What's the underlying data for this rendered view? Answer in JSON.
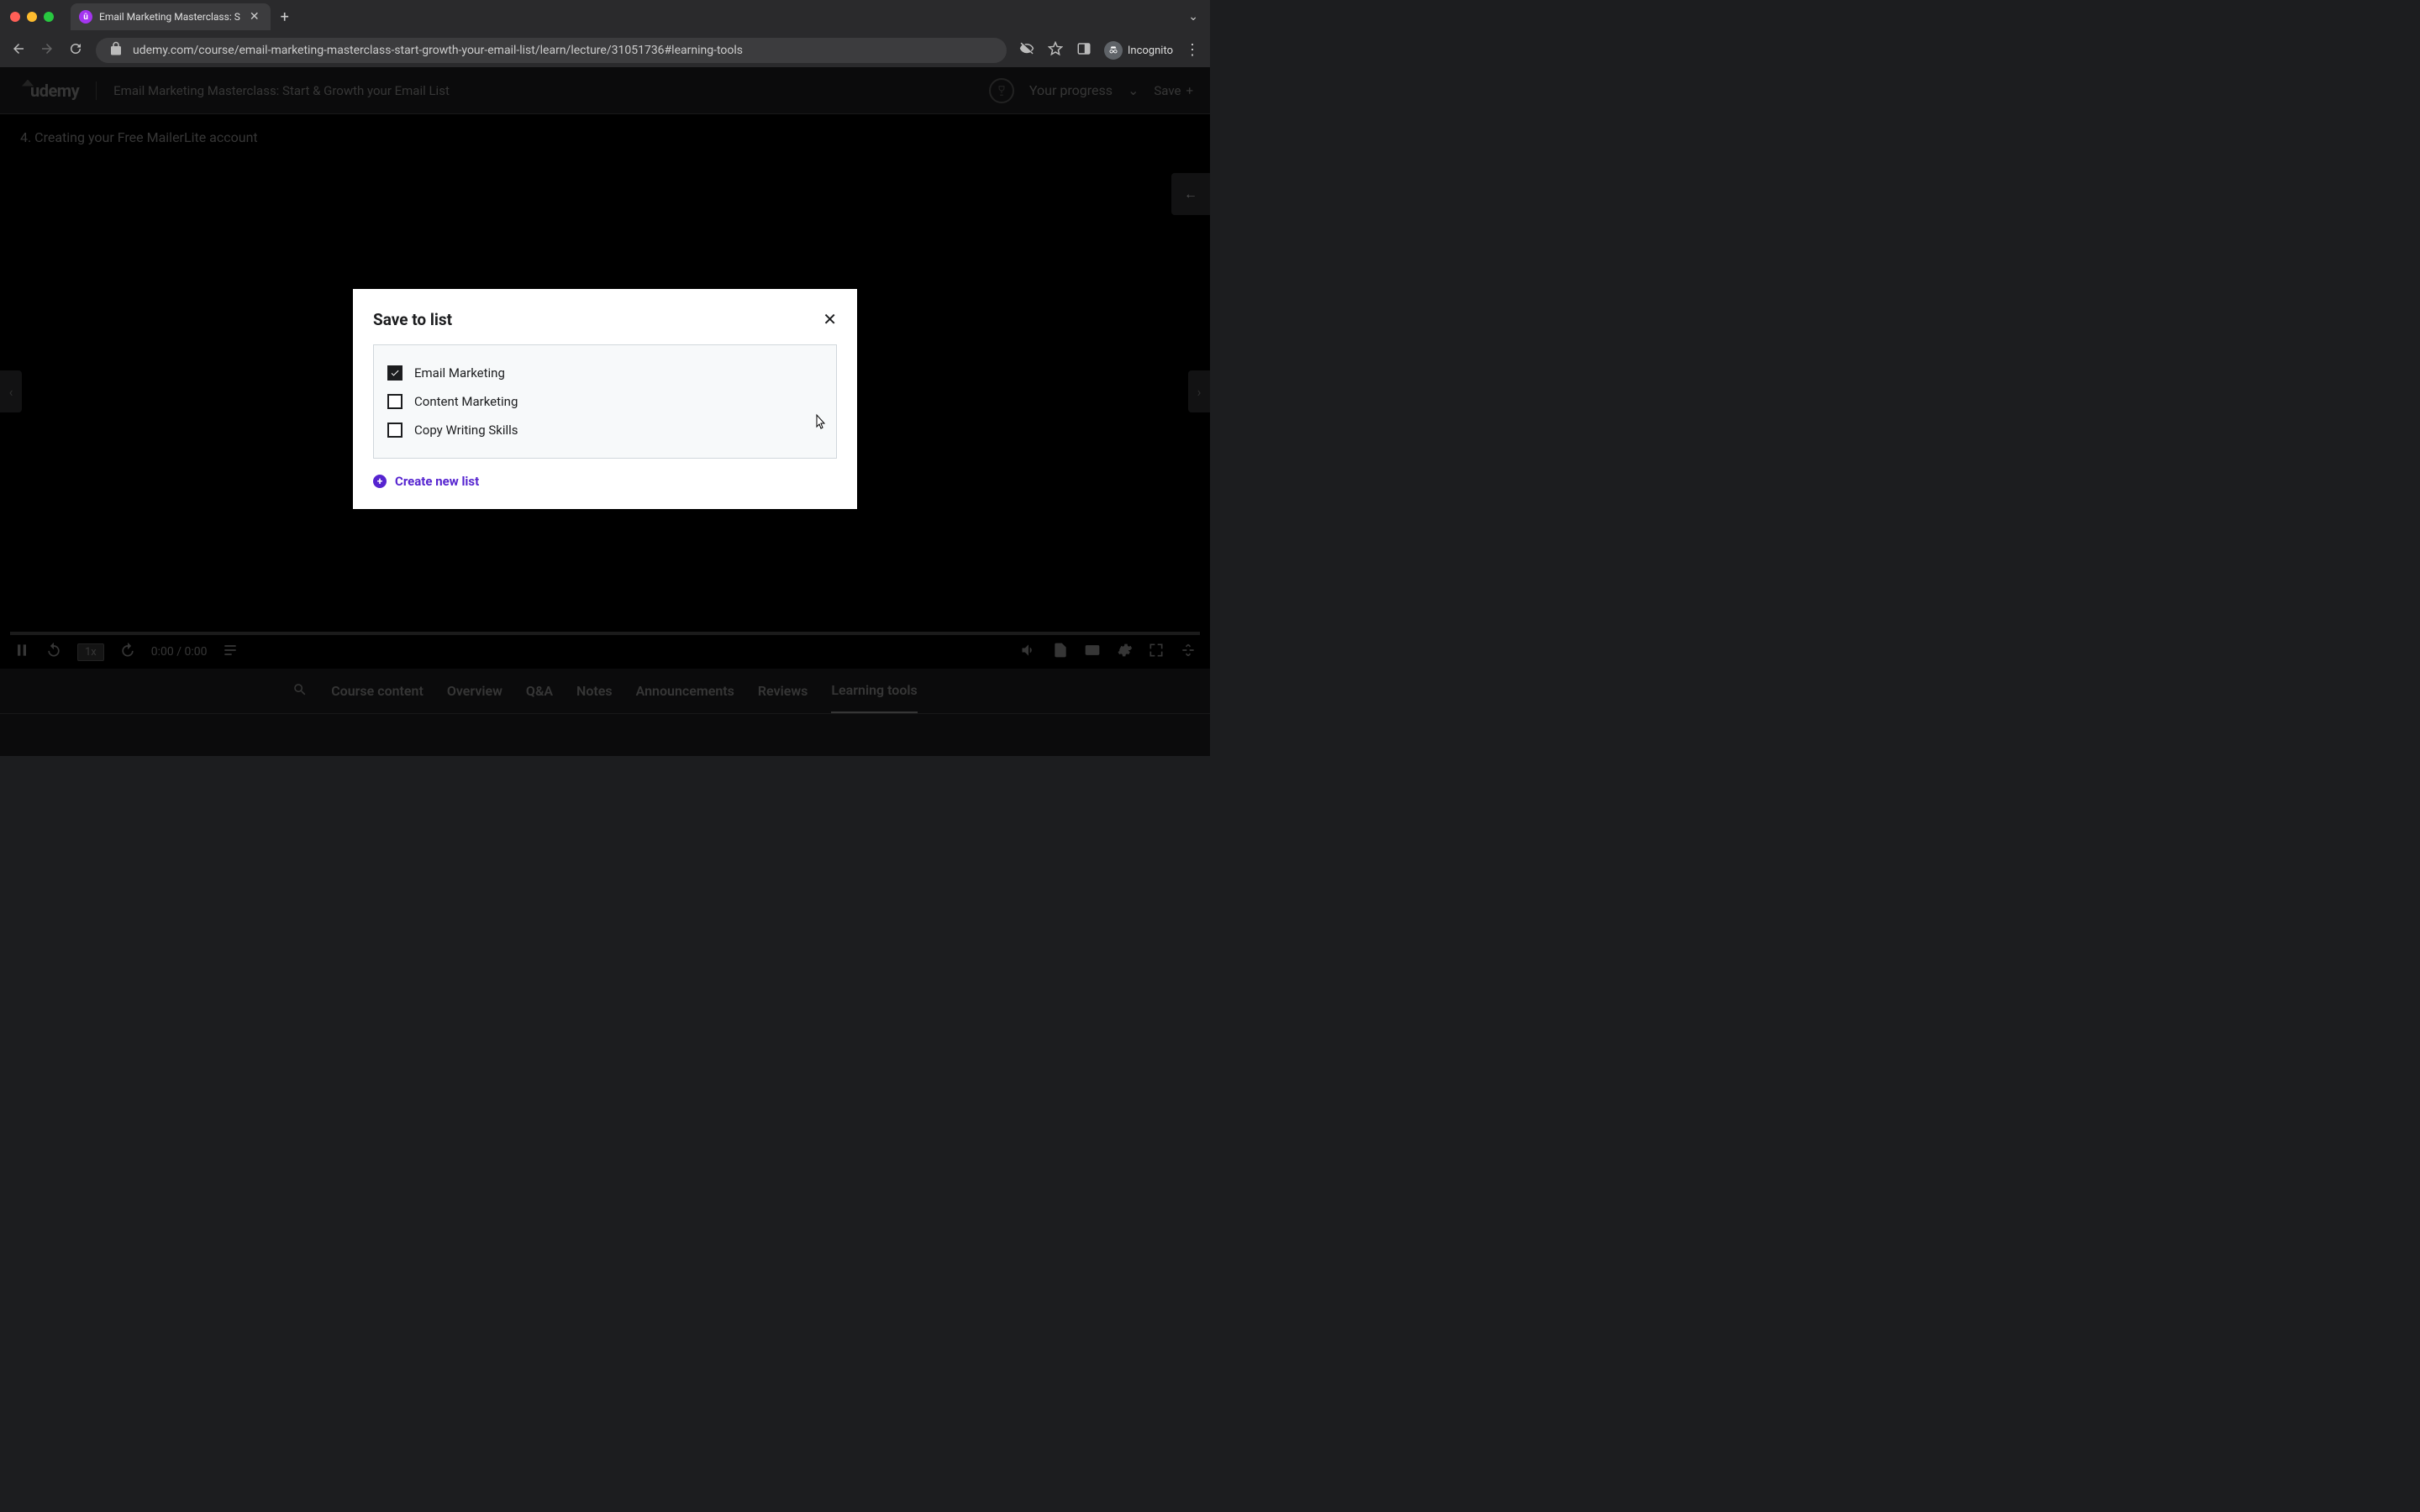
{
  "browser": {
    "tab_title": "Email Marketing Masterclass: S",
    "url": "udemy.com/course/email-marketing-masterclass-start-growth-your-email-list/learn/lecture/31051736#learning-tools",
    "incognito_label": "Incognito"
  },
  "header": {
    "logo": "udemy",
    "course_title": "Email Marketing Masterclass: Start & Growth your Email List",
    "your_progress": "Your progress",
    "save_label": "Save"
  },
  "lecture": {
    "title": "4. Creating your Free MailerLite account"
  },
  "player": {
    "speed": "1x",
    "time": "0:00 / 0:00"
  },
  "tabs": [
    {
      "label": "Course content",
      "active": false
    },
    {
      "label": "Overview",
      "active": false
    },
    {
      "label": "Q&A",
      "active": false
    },
    {
      "label": "Notes",
      "active": false
    },
    {
      "label": "Announcements",
      "active": false
    },
    {
      "label": "Reviews",
      "active": false
    },
    {
      "label": "Learning tools",
      "active": true
    }
  ],
  "modal": {
    "title": "Save to list",
    "lists": [
      {
        "label": "Email Marketing",
        "checked": true
      },
      {
        "label": "Content Marketing",
        "checked": false
      },
      {
        "label": "Copy Writing Skills",
        "checked": false
      }
    ],
    "create_new": "Create new list"
  }
}
